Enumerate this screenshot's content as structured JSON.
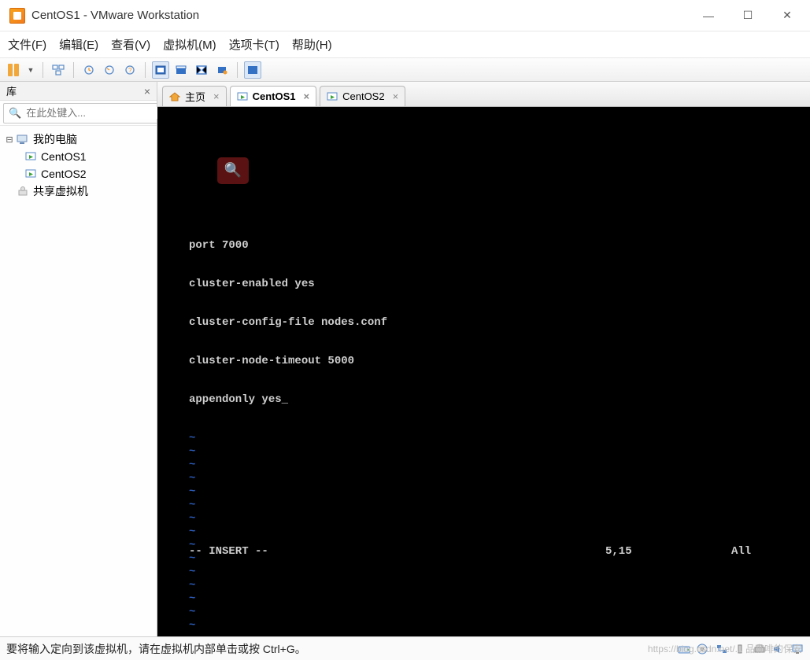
{
  "window": {
    "title": "CentOS1 - VMware Workstation",
    "minimize": "—",
    "maximize": "☐",
    "close": "✕"
  },
  "menu": {
    "file": "文件(F)",
    "edit": "编辑(E)",
    "view": "查看(V)",
    "vm": "虚拟机(M)",
    "tabs": "选项卡(T)",
    "help": "帮助(H)"
  },
  "sidebar": {
    "title": "库",
    "close": "×",
    "search_placeholder": "在此处键入...",
    "tree": {
      "root": "我的电脑",
      "items": [
        "CentOS1",
        "CentOS2"
      ],
      "shared": "共享虚拟机"
    }
  },
  "tabs": [
    {
      "label": "主页",
      "icon": "home",
      "active": false
    },
    {
      "label": "CentOS1",
      "icon": "vm",
      "active": true
    },
    {
      "label": "CentOS2",
      "icon": "vm",
      "active": false
    }
  ],
  "console": {
    "lines": [
      "port 7000",
      "cluster-enabled yes",
      "cluster-config-file nodes.conf",
      "cluster-node-timeout 5000",
      "appendonly yes"
    ],
    "mode": "-- INSERT --",
    "position": "5,15",
    "scroll": "All",
    "tilde": "~"
  },
  "statusbar": {
    "text": "要将输入定向到该虚拟机，请在虚拟机内部单击或按 Ctrl+G。"
  },
  "watermark": "https://blog.csdn.net/... 品咖啡的保安"
}
